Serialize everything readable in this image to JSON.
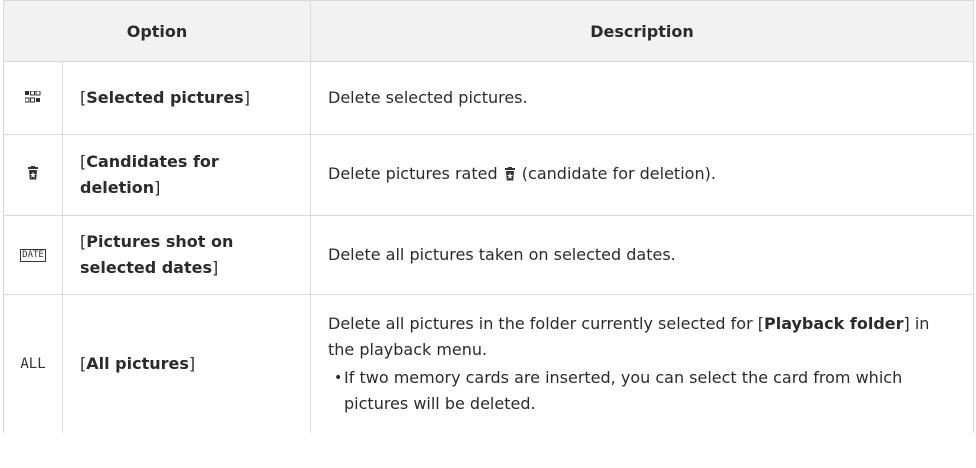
{
  "headers": {
    "option": "Option",
    "description": "Description"
  },
  "rows": [
    {
      "icon": "selected-pictures-grid-icon",
      "option_open": "[",
      "option_bold": "Selected pictures",
      "option_close": "]",
      "description": "Delete selected pictures."
    },
    {
      "icon": "candidate-for-deletion-trash-icon",
      "option_open": "[",
      "option_bold": "Candidates for deletion",
      "option_close": "]",
      "description_pre": "Delete pictures rated ",
      "description_post": " (candidate for deletion)."
    },
    {
      "icon_text": "DATE",
      "option_open": "[",
      "option_bold": "Pictures shot on selected dates",
      "option_close": "]",
      "description": "Delete all pictures taken on selected dates."
    },
    {
      "icon_text": "ALL",
      "option_open": "[",
      "option_bold": "All pictures",
      "option_close": "]",
      "description_pre": "Delete all pictures in the folder currently selected for [",
      "description_bold": "Playback folder",
      "description_post": "] in the playback menu.",
      "bullet": "If two memory cards are inserted, you can select the card from which pictures will be deleted."
    }
  ]
}
